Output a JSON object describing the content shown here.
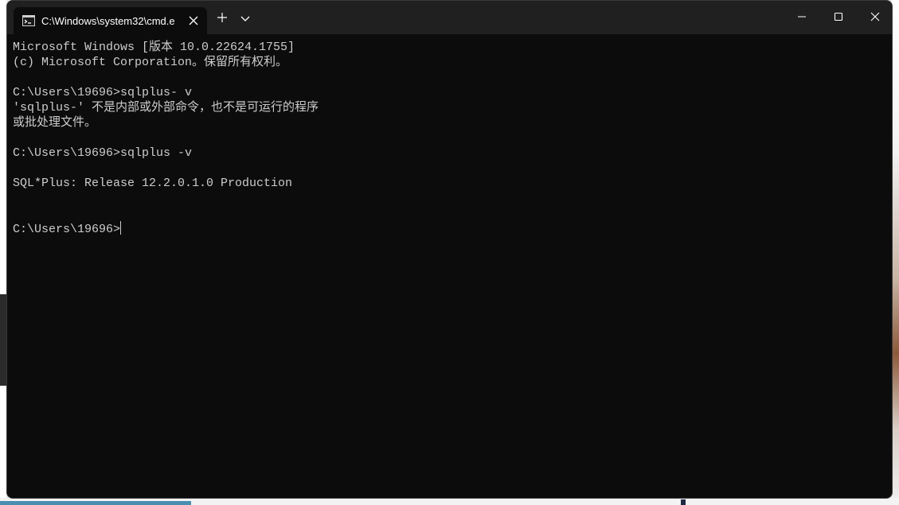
{
  "window": {
    "tab_title": "C:\\Windows\\system32\\cmd.e",
    "tab_icon": "cmd-icon",
    "controls": {
      "close_tab_icon": "close-icon",
      "new_tab_icon": "plus-icon",
      "dropdown_icon": "chevron-down-icon",
      "minimize_icon": "minimize-icon",
      "maximize_icon": "maximize-icon",
      "close_window_icon": "close-icon"
    }
  },
  "console": {
    "lines": [
      "Microsoft Windows [版本 10.0.22624.1755]",
      "(c) Microsoft Corporation。保留所有权利。",
      "",
      "C:\\Users\\19696>sqlplus- v",
      "'sqlplus-' 不是内部或外部命令，也不是可运行的程序",
      "或批处理文件。",
      "",
      "C:\\Users\\19696>sqlplus -v",
      "",
      "SQL*Plus: Release 12.2.0.1.0 Production",
      "",
      ""
    ],
    "prompt": "C:\\Users\\19696>"
  },
  "colors": {
    "console_bg": "#0c0c0c",
    "titlebar_bg": "#202020",
    "text": "#cccccc"
  }
}
